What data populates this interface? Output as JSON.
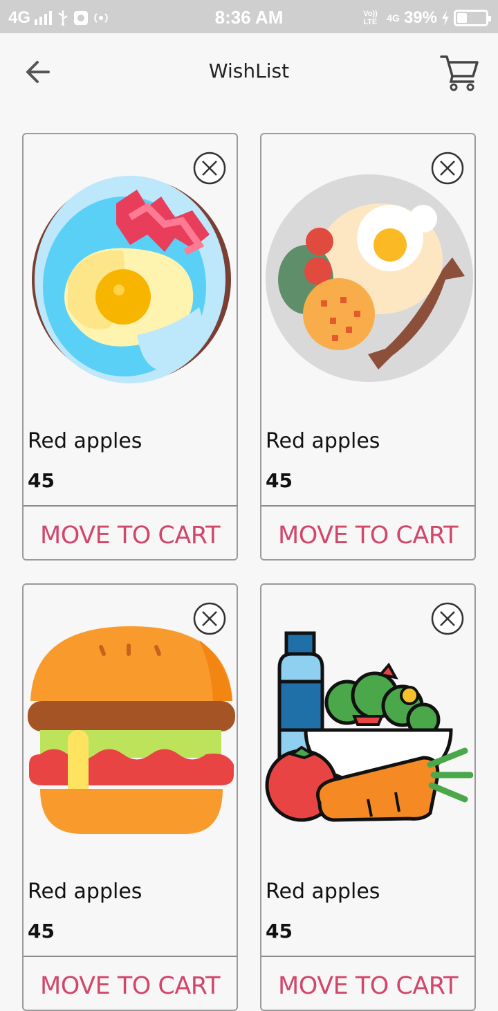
{
  "status_bar": {
    "network": "4G",
    "time": "8:36 AM",
    "volte": "Vo)) LTE",
    "net2": "4G",
    "battery": "39%"
  },
  "header": {
    "title": "WishList"
  },
  "products": [
    {
      "name": "Red apples",
      "price": "45",
      "action": "MOVE TO CART",
      "image_icon": "bacon-egg-plate-icon"
    },
    {
      "name": "Red apples",
      "price": "45",
      "action": "MOVE TO CART",
      "image_icon": "breakfast-plate-icon"
    },
    {
      "name": "Red apples",
      "price": "45",
      "action": "MOVE TO CART",
      "image_icon": "burger-icon"
    },
    {
      "name": "Red apples",
      "price": "45",
      "action": "MOVE TO CART",
      "image_icon": "salad-bowl-icon"
    }
  ],
  "colors": {
    "accent": "#d2466a",
    "status_bar_bg": "#cfcfcf",
    "background": "#f7f7f7"
  }
}
